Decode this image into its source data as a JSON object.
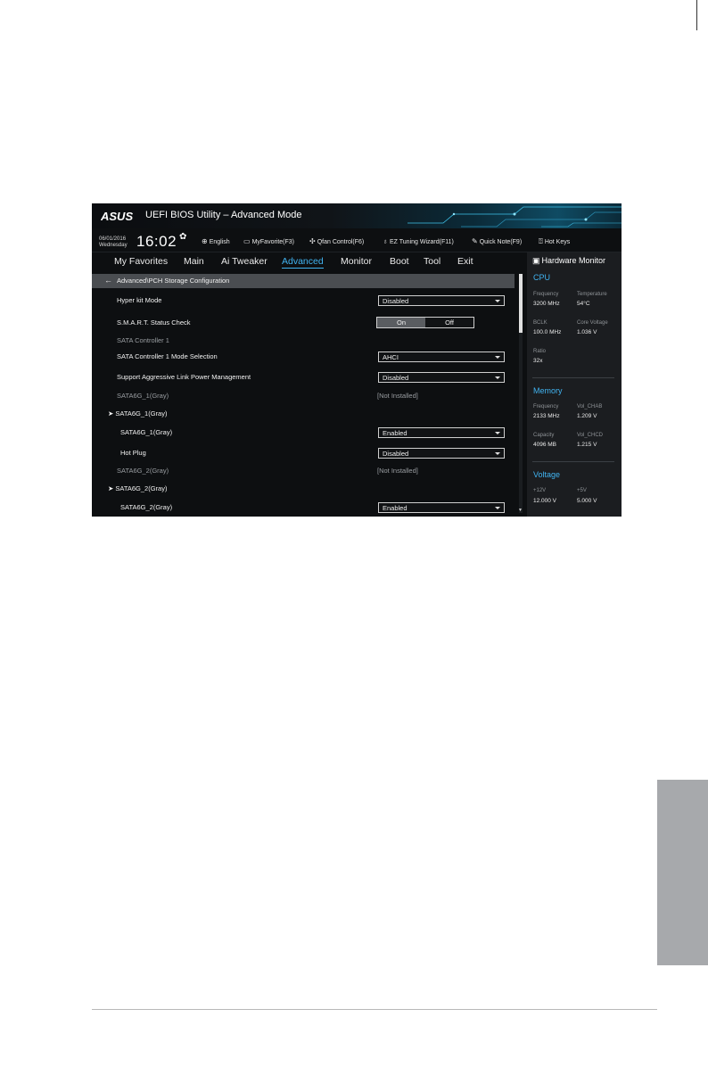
{
  "window": {
    "brand": "ASUS",
    "title": "UEFI BIOS Utility – Advanced Mode"
  },
  "infobar": {
    "date": "06/01/2016",
    "day": "Wednesday",
    "time": "16:02",
    "tools": [
      {
        "icon": "globe-icon",
        "label": "English"
      },
      {
        "icon": "star-list-icon",
        "label": "MyFavorite(F3)"
      },
      {
        "icon": "fan-icon",
        "label": "Qfan Control(F6)"
      },
      {
        "icon": "lightbulb-icon",
        "label": "EZ Tuning Wizard(F11)"
      },
      {
        "icon": "note-icon",
        "label": "Quick Note(F9)"
      },
      {
        "icon": "question-icon",
        "label": "Hot Keys"
      }
    ]
  },
  "nav": {
    "tabs": [
      "My Favorites",
      "Main",
      "Ai Tweaker",
      "Advanced",
      "Monitor",
      "Boot",
      "Tool",
      "Exit"
    ],
    "active": "Advanced"
  },
  "breadcrumb": "Advanced\\PCH Storage Configuration",
  "settings": {
    "hyper_kit_mode": {
      "label": "Hyper kit Mode",
      "value": "Disabled"
    },
    "smart_status": {
      "label": "S.M.A.R.T. Status Check",
      "on": "On",
      "off": "Off"
    },
    "sata_controller": {
      "label": "SATA Controller 1"
    },
    "sata_mode": {
      "label": "SATA Controller 1 Mode Selection",
      "value": "AHCI"
    },
    "alpm": {
      "label": "Support Aggressive Link Power Management",
      "value": "Disabled"
    },
    "port1_status": {
      "label": "SATA6G_1(Gray)",
      "value": "[Not Installed]"
    },
    "port1_group": {
      "label": "SATA6G_1(Gray)"
    },
    "port1_enable": {
      "label": "SATA6G_1(Gray)",
      "value": "Enabled"
    },
    "port1_hotplug": {
      "label": "Hot Plug",
      "value": "Disabled"
    },
    "port2_status": {
      "label": "SATA6G_2(Gray)",
      "value": "[Not Installed]"
    },
    "port2_group": {
      "label": "SATA6G_2(Gray)"
    },
    "port2_enable": {
      "label": "SATA6G_2(Gray)",
      "value": "Enabled"
    }
  },
  "hardware_monitor": {
    "title": "Hardware Monitor",
    "cpu": {
      "title": "CPU",
      "frequency_label": "Frequency",
      "frequency": "3200 MHz",
      "temperature_label": "Temperature",
      "temperature": "54°C",
      "bclk_label": "BCLK",
      "bclk": "100.0 MHz",
      "core_voltage_label": "Core Voltage",
      "core_voltage": "1.036 V",
      "ratio_label": "Ratio",
      "ratio": "32x"
    },
    "memory": {
      "title": "Memory",
      "frequency_label": "Frequency",
      "frequency": "2133 MHz",
      "vol_chab_label": "Vol_CHAB",
      "vol_chab": "1.209 V",
      "capacity_label": "Capacity",
      "capacity": "4096 MB",
      "vol_chcd_label": "Vol_CHCD",
      "vol_chcd": "1.215 V"
    },
    "voltage": {
      "title": "Voltage",
      "v12_label": "+12V",
      "v12": "12.000 V",
      "v5_label": "+5V",
      "v5": "5.000 V"
    }
  }
}
